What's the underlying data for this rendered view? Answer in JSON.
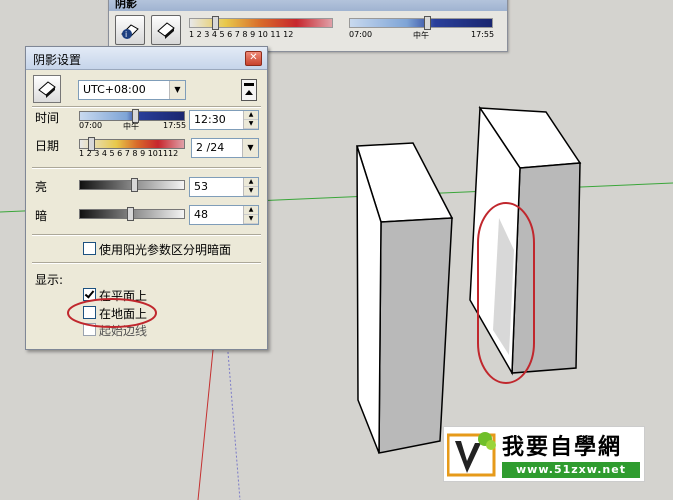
{
  "toolbar": {
    "title": "阴影",
    "month_ticks": "1 2 3 4 5 6 7 8 9 10 11 12",
    "time_start": "07:00",
    "time_mid": "中午",
    "time_end": "17:55"
  },
  "dialog": {
    "title": "阴影设置",
    "close_glyph": "✕",
    "timezone": "UTC+08:00",
    "time_label": "时间",
    "time_start": "07:00",
    "time_mid": "中午",
    "time_end": "17:55",
    "time_value": "12:30",
    "date_label": "日期",
    "month_ticks": "1 2 3 4 5 6 7 8 9 101112",
    "date_value": "2 /24",
    "light_label": "亮",
    "light_value": "53",
    "light_fraction": 0.53,
    "dark_label": "暗",
    "dark_value": "48",
    "dark_fraction": 0.48,
    "sun_dark_label": "使用阳光参数区分明暗面",
    "sun_dark_checked": false,
    "display_label": "显示:",
    "on_faces_label": "在平面上",
    "on_faces_checked": true,
    "on_ground_label": "在地面上",
    "on_ground_checked": false,
    "from_edges_label": "起始边线",
    "from_edges_checked": false
  },
  "logo": {
    "text": "我要自學網",
    "url": "www.51zxw.net"
  },
  "colors": {
    "highlight_ellipse": "#c0272d",
    "ground_axis": "#3aa63a",
    "red_axis": "#c43030",
    "blue_axis": "#3a3aaa"
  },
  "icons": [
    "sun-shadow-icon",
    "shadow-toggle-icon",
    "collapse-icon",
    "close-icon",
    "dropdown-arrow-icon"
  ]
}
